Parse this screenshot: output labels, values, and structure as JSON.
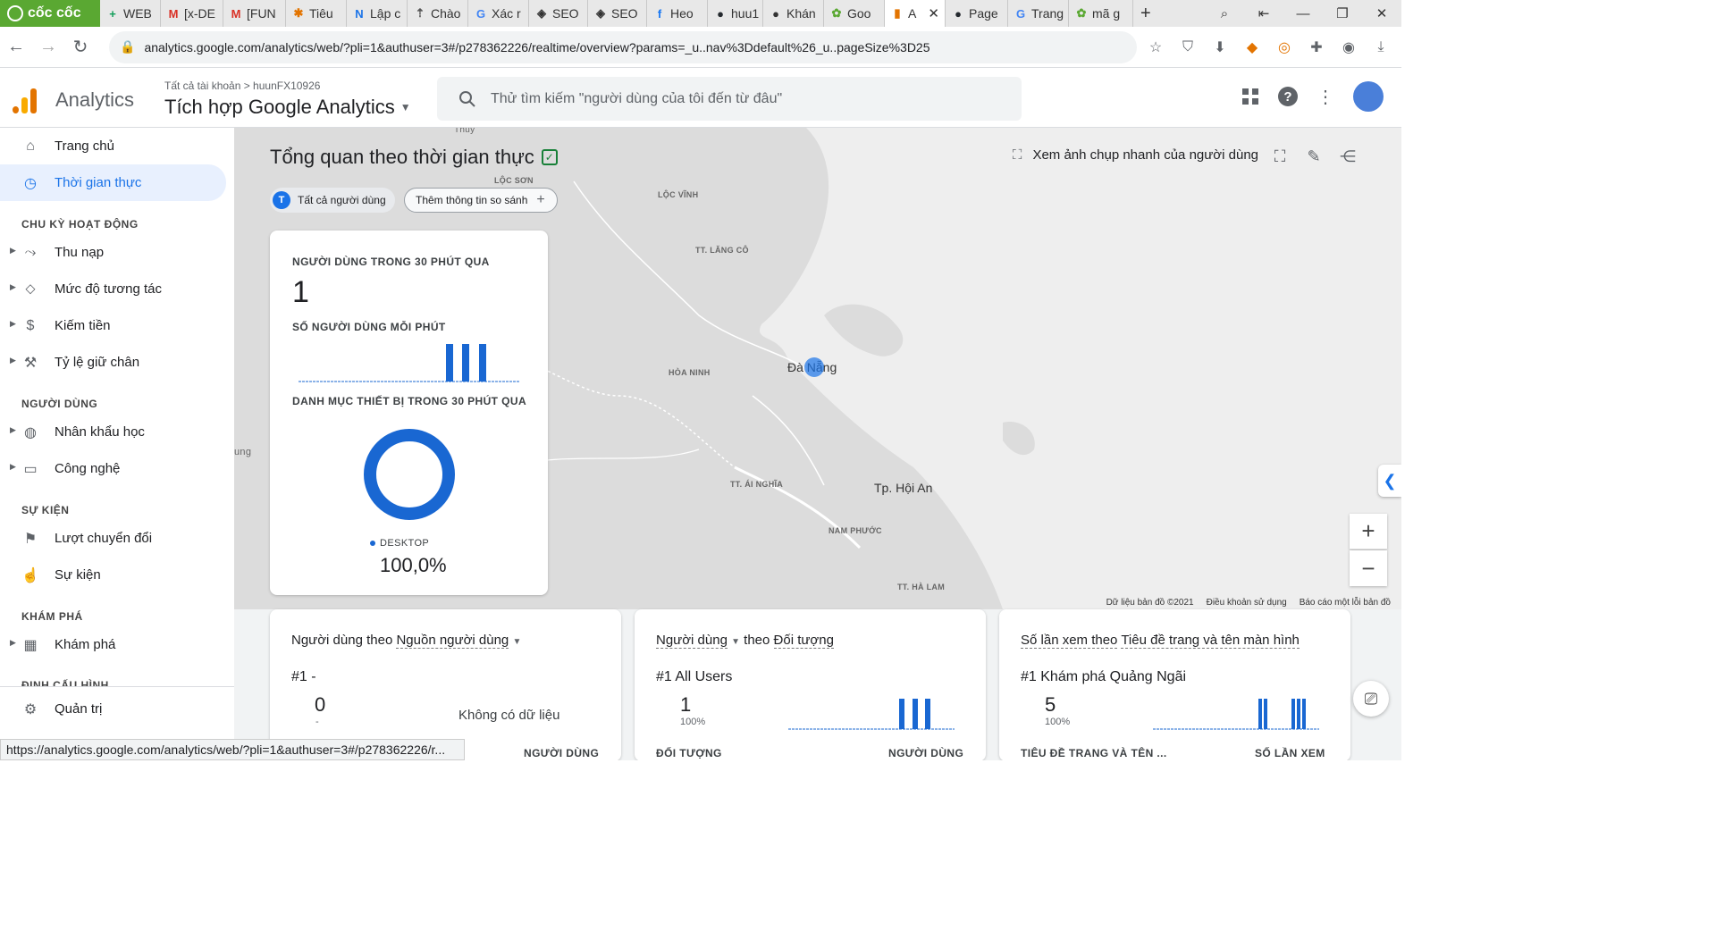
{
  "browser": {
    "brand": "cốc cốc",
    "tabs": [
      {
        "label": "WEB",
        "icon": "+",
        "color": "#0f9d58"
      },
      {
        "label": "[x-DE",
        "icon": "M",
        "color": "#d93025"
      },
      {
        "label": "[FUN",
        "icon": "M",
        "color": "#d93025"
      },
      {
        "label": "Tiêu",
        "icon": "✱",
        "color": "#e37400"
      },
      {
        "label": "Lập c",
        "icon": "N",
        "color": "#1a73e8"
      },
      {
        "label": "Chào",
        "icon": "⇡",
        "color": "#555555"
      },
      {
        "label": "Xác r",
        "icon": "G",
        "color": "#4285f4"
      },
      {
        "label": "SEO",
        "icon": "◈",
        "color": "#333333"
      },
      {
        "label": "SEO",
        "icon": "◈",
        "color": "#333333"
      },
      {
        "label": "Heo",
        "icon": "f",
        "color": "#1877f2"
      },
      {
        "label": "huu1",
        "icon": "●",
        "color": "#24292e"
      },
      {
        "label": "Khán",
        "icon": "●",
        "color": "#333333"
      },
      {
        "label": "Goo",
        "icon": "✿",
        "color": "#5aa832"
      },
      {
        "label": "A",
        "icon": "▮",
        "color": "#e37400"
      },
      {
        "label": "Page",
        "icon": "●",
        "color": "#24292e"
      },
      {
        "label": "Trang",
        "icon": "G",
        "color": "#4285f4"
      },
      {
        "label": "mã g",
        "icon": "✿",
        "color": "#5aa832"
      }
    ],
    "active_tab_index": 13,
    "url": "analytics.google.com/analytics/web/?pli=1&authuser=3#/p278362226/realtime/overview?params=_u..nav%3Ddefault%26_u..pageSize%3D25",
    "status_url": "https://analytics.google.com/analytics/web/?pli=1&authuser=3#/p278362226/r..."
  },
  "header": {
    "app_title": "Analytics",
    "breadcrumb": "Tất cả tài khoản > huunFX10926",
    "property": "Tích hợp Google Analytics",
    "search_placeholder": "Thử tìm kiếm \"người dùng của tôi đến từ đâu\""
  },
  "sidebar": {
    "items": [
      {
        "label": "Trang chủ",
        "icon": "home-icon",
        "active": false
      },
      {
        "label": "Thời gian thực",
        "icon": "clock-icon",
        "active": true
      }
    ],
    "sections": [
      {
        "title": "CHU KỲ HOẠT ĐỘNG",
        "items": [
          "Thu nạp",
          "Mức độ tương tác",
          "Kiếm tiền",
          "Tỷ lệ giữ chân"
        ]
      },
      {
        "title": "NGƯỜI DÙNG",
        "items": [
          "Nhân khẩu học",
          "Công nghệ"
        ]
      },
      {
        "title": "SỰ KIỆN",
        "items": [
          "Lượt chuyển đổi",
          "Sự kiện"
        ]
      },
      {
        "title": "KHÁM PHÁ",
        "items": [
          "Khám phá"
        ]
      },
      {
        "title": "ĐỊNH CẤU HÌNH"
      }
    ],
    "admin": "Quản trị"
  },
  "realtime": {
    "title": "Tổng quan theo thời gian thực",
    "chip_all_users": "Tất cả người dùng",
    "chip_avatar": "T",
    "chip_compare": "Thêm thông tin so sánh",
    "snapshot": "Xem ảnh chụp nhanh của người dùng",
    "card": {
      "users_label": "NGƯỜI DÙNG TRONG 30 PHÚT QUA",
      "users_value": "1",
      "per_min_label": "SỐ NGƯỜI DÙNG MỖI PHÚT",
      "device_label": "DANH MỤC THIẾT BỊ TRONG 30 PHÚT QUA",
      "device_name": "DESKTOP",
      "device_pct": "100,0%"
    },
    "accent": "#1a73e8",
    "chart_color": "#1967d2"
  },
  "map": {
    "labels": [
      "Thủy",
      "LỘC SƠN",
      "LỘC VĨNH",
      "TT. LĂNG CÔ",
      "HÒA NINH",
      "TT. ÁI NGHĨA",
      "NAM PHƯỚC",
      "TT. HÀ LAM",
      "ung"
    ],
    "cities": [
      "Đà Nẵng",
      "Tp. Hội An"
    ],
    "attribution": [
      "Dữ liệu bản đồ ©2021",
      "Điều khoản sử dụng",
      "Báo cáo một lỗi bản đồ"
    ],
    "zoom_in": "+",
    "zoom_out": "−"
  },
  "cards": [
    {
      "title_a": "Người dùng theo",
      "title_b": "Nguồn người dùng",
      "rank": "#1",
      "rank_name": "-",
      "value": "0",
      "pct": "-",
      "no_data": "Không có dữ liệu",
      "foot_left": "",
      "foot_right": "NGƯỜI DÙNG"
    },
    {
      "title_a": "Người dùng",
      "title_b": "theo",
      "title_c": "Đối tượng",
      "rank": "#1",
      "rank_name": "All Users",
      "value": "1",
      "pct": "100%",
      "foot_left": "ĐỐI TƯỢNG",
      "foot_right": "NGƯỜI DÙNG"
    },
    {
      "title_a": "Số lần xem theo",
      "title_b": "Tiêu đề trang và tên màn hình",
      "rank": "#1",
      "rank_name": "Khám phá Quảng Ngãi",
      "value": "5",
      "pct": "100%",
      "foot_left": "TIÊU ĐỀ TRANG VÀ TÊN ...",
      "foot_right": "SỐ LẦN XEM"
    }
  ]
}
